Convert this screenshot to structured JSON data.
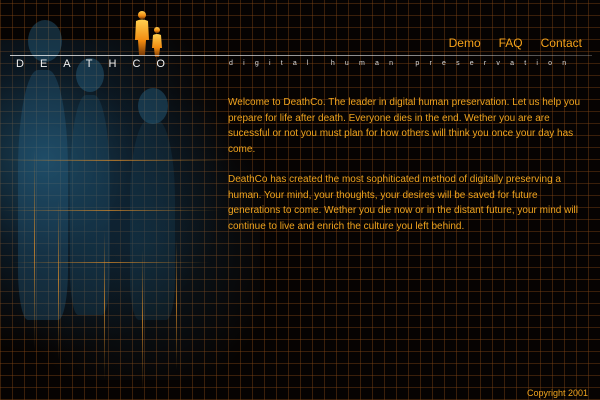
{
  "brand": {
    "name": "DEATHCO",
    "tagline": "digital human preservation"
  },
  "nav": {
    "items": [
      {
        "label": "Demo"
      },
      {
        "label": "FAQ"
      },
      {
        "label": "Contact"
      }
    ]
  },
  "content": {
    "paragraphs": [
      "Welcome to DeathCo. The leader in digital human preservation. Let us help you prepare for life after death. Everyone dies in the end.  Wether you are are sucessful or not you must plan for how others will think you once your day has come.",
      "DeathCo has created the most sophiticated method of digitally preserving a human.  Your mind, your thoughts, your desires will be saved for future generations to come.  Wether you die now or in the distant future, your mind will continue to live and enrich the culture you left behind."
    ]
  },
  "footer": {
    "copyright": "Copyright 2001"
  },
  "colors": {
    "accent": "#f0a41e",
    "background": "#060302",
    "grid": "#82461a",
    "figures": "#2d6e96"
  },
  "icons": {
    "logo": "human-figures-icon"
  }
}
